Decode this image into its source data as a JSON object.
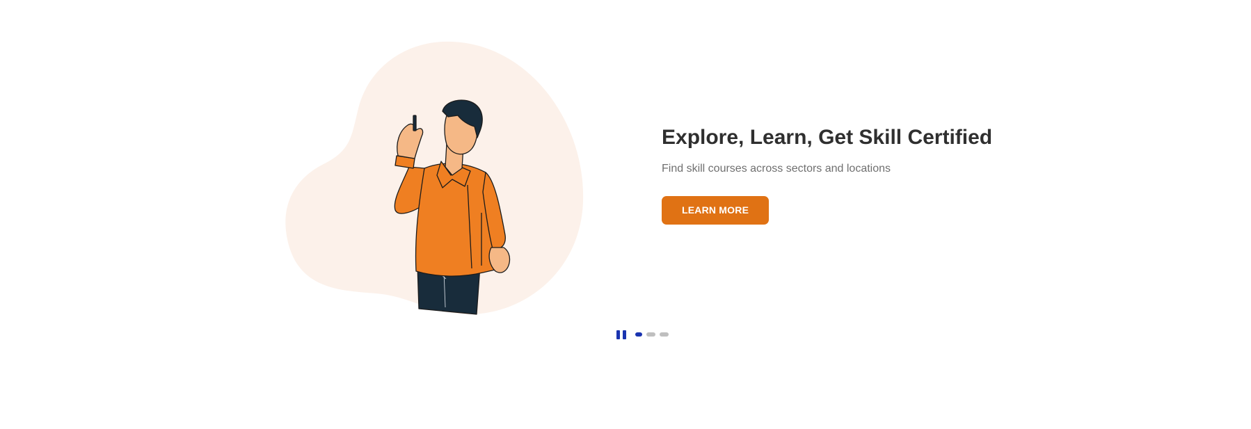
{
  "hero": {
    "headline": "Explore, Learn, Get Skill Certified",
    "subtitle": "Find skill courses across sectors and locations",
    "cta_label": "LEARN MORE",
    "illustration_icon": "man-pointing-up-illustration"
  },
  "carousel": {
    "pause_icon": "pause-icon",
    "slide_count": 3,
    "active_slide": 1
  },
  "colors": {
    "accent": "#e07214",
    "blob": "#fcf1ea",
    "shirt": "#ef7f22",
    "skin": "#f5b886",
    "dark": "#182c3b",
    "indicator_active": "#1a34b0",
    "indicator_inactive": "#bfbfbf",
    "headline_text": "#2f2f2f",
    "subtitle_text": "#6f6f6f"
  }
}
